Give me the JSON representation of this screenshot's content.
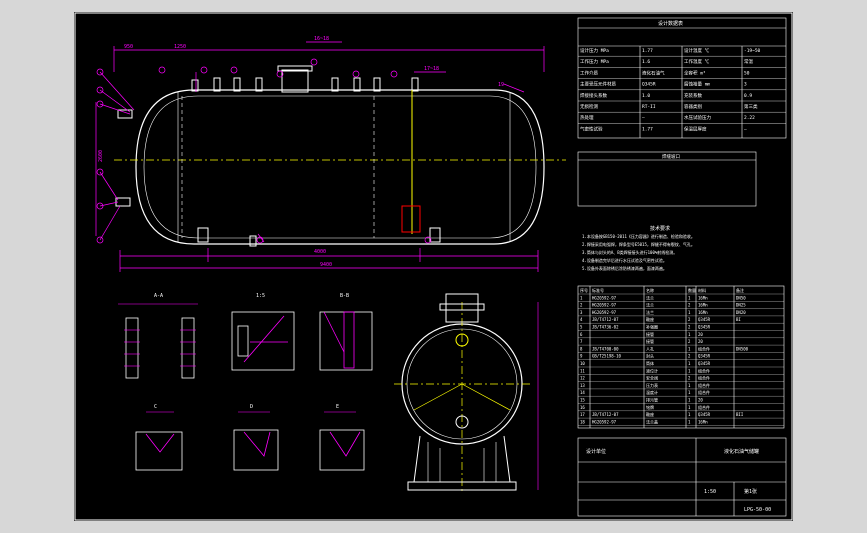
{
  "header_title": "设计数据表",
  "data_rows": [
    [
      "设计压力 MPa",
      "1.77",
      "设计温度 ℃",
      "-19~50"
    ],
    [
      "工作压力 MPa",
      "1.6",
      "工作温度 ℃",
      "常温"
    ],
    [
      "工作介质",
      "液化石油气",
      "全容积 m³",
      "50"
    ],
    [
      "主要受压元件材质",
      "Q345R",
      "腐蚀裕量 mm",
      "3"
    ],
    [
      "焊接接头系数",
      "1.0",
      "充装系数",
      "0.9"
    ],
    [
      "无损检测",
      "RT-II",
      "容器类别",
      "第三类"
    ],
    [
      "热处理",
      "—",
      "水压试验压力",
      "2.22"
    ],
    [
      "气密性试验",
      "1.77",
      "保温层厚度",
      "—"
    ]
  ],
  "weld_title": "焊缝坡口",
  "tech_title": "技术要求",
  "tech_lines": [
    "1.本设备按GB150-2011《压力容器》进行制造、检验和验收。",
    "2.焊接采用电弧焊，焊条型号E5015，焊缝不得有裂纹、气孔。",
    "3.筒体与封头的A、B类焊接接头进行100%射线检测。",
    "4.设备制造完毕后进行水压试验及气密性试验。",
    "5.设备外表面除锈后涂防锈漆两遍，面漆两遍。"
  ],
  "nozzle_header": [
    "序号",
    "标准号",
    "名称",
    "数量",
    "材料",
    "备注"
  ],
  "nozzle_rows": [
    [
      "1",
      "HG20592-97",
      "法兰",
      "1",
      "16Mn",
      "DN50"
    ],
    [
      "2",
      "HG20592-97",
      "法兰",
      "2",
      "16Mn",
      "DN25"
    ],
    [
      "3",
      "HG20592-97",
      "法兰",
      "1",
      "16Mn",
      "DN20"
    ],
    [
      "4",
      "JB/T4712-07",
      "鞍座",
      "2",
      "Q345R",
      "BI"
    ],
    [
      "5",
      "JB/T4736-02",
      "补强圈",
      "2",
      "Q345R",
      ""
    ],
    [
      "6",
      "",
      "接管",
      "1",
      "20",
      ""
    ],
    [
      "7",
      "",
      "接管",
      "2",
      "20",
      ""
    ],
    [
      "8",
      "JB/T4700-00",
      "人孔",
      "1",
      "组合件",
      "DN500"
    ],
    [
      "9",
      "GB/T25198-10",
      "封头",
      "2",
      "Q345R",
      ""
    ],
    [
      "10",
      "",
      "筒体",
      "1",
      "Q345R",
      ""
    ],
    [
      "11",
      "",
      "液位计",
      "1",
      "组合件",
      ""
    ],
    [
      "12",
      "",
      "安全阀",
      "2",
      "组合件",
      ""
    ],
    [
      "13",
      "",
      "压力表",
      "1",
      "组合件",
      ""
    ],
    [
      "14",
      "",
      "温度计",
      "1",
      "组合件",
      ""
    ],
    [
      "15",
      "",
      "排污管",
      "1",
      "20",
      ""
    ],
    [
      "16",
      "",
      "铭牌",
      "1",
      "组合件",
      ""
    ],
    [
      "17",
      "JB/T4712-07",
      "鞍座",
      "1",
      "Q345R",
      "BII"
    ],
    [
      "18",
      "HG20592-97",
      "法兰盖",
      "1",
      "16Mn",
      ""
    ]
  ],
  "title_block": {
    "drawing_name": "液化石油气储罐",
    "company": "设计单位",
    "scale": "1:50",
    "sheet": "第1张",
    "drawing_no": "LPG-50-00"
  },
  "section_labels": [
    "A-A",
    "1:5",
    "B-B",
    "C",
    "D",
    "E"
  ],
  "dims": [
    "4000",
    "9400",
    "12000",
    "2600"
  ],
  "colors": {
    "line": "#ffffff",
    "dim": "#ff00ff",
    "center": "#ffff00",
    "accent": "#ff0000",
    "table": "#ffffff"
  }
}
